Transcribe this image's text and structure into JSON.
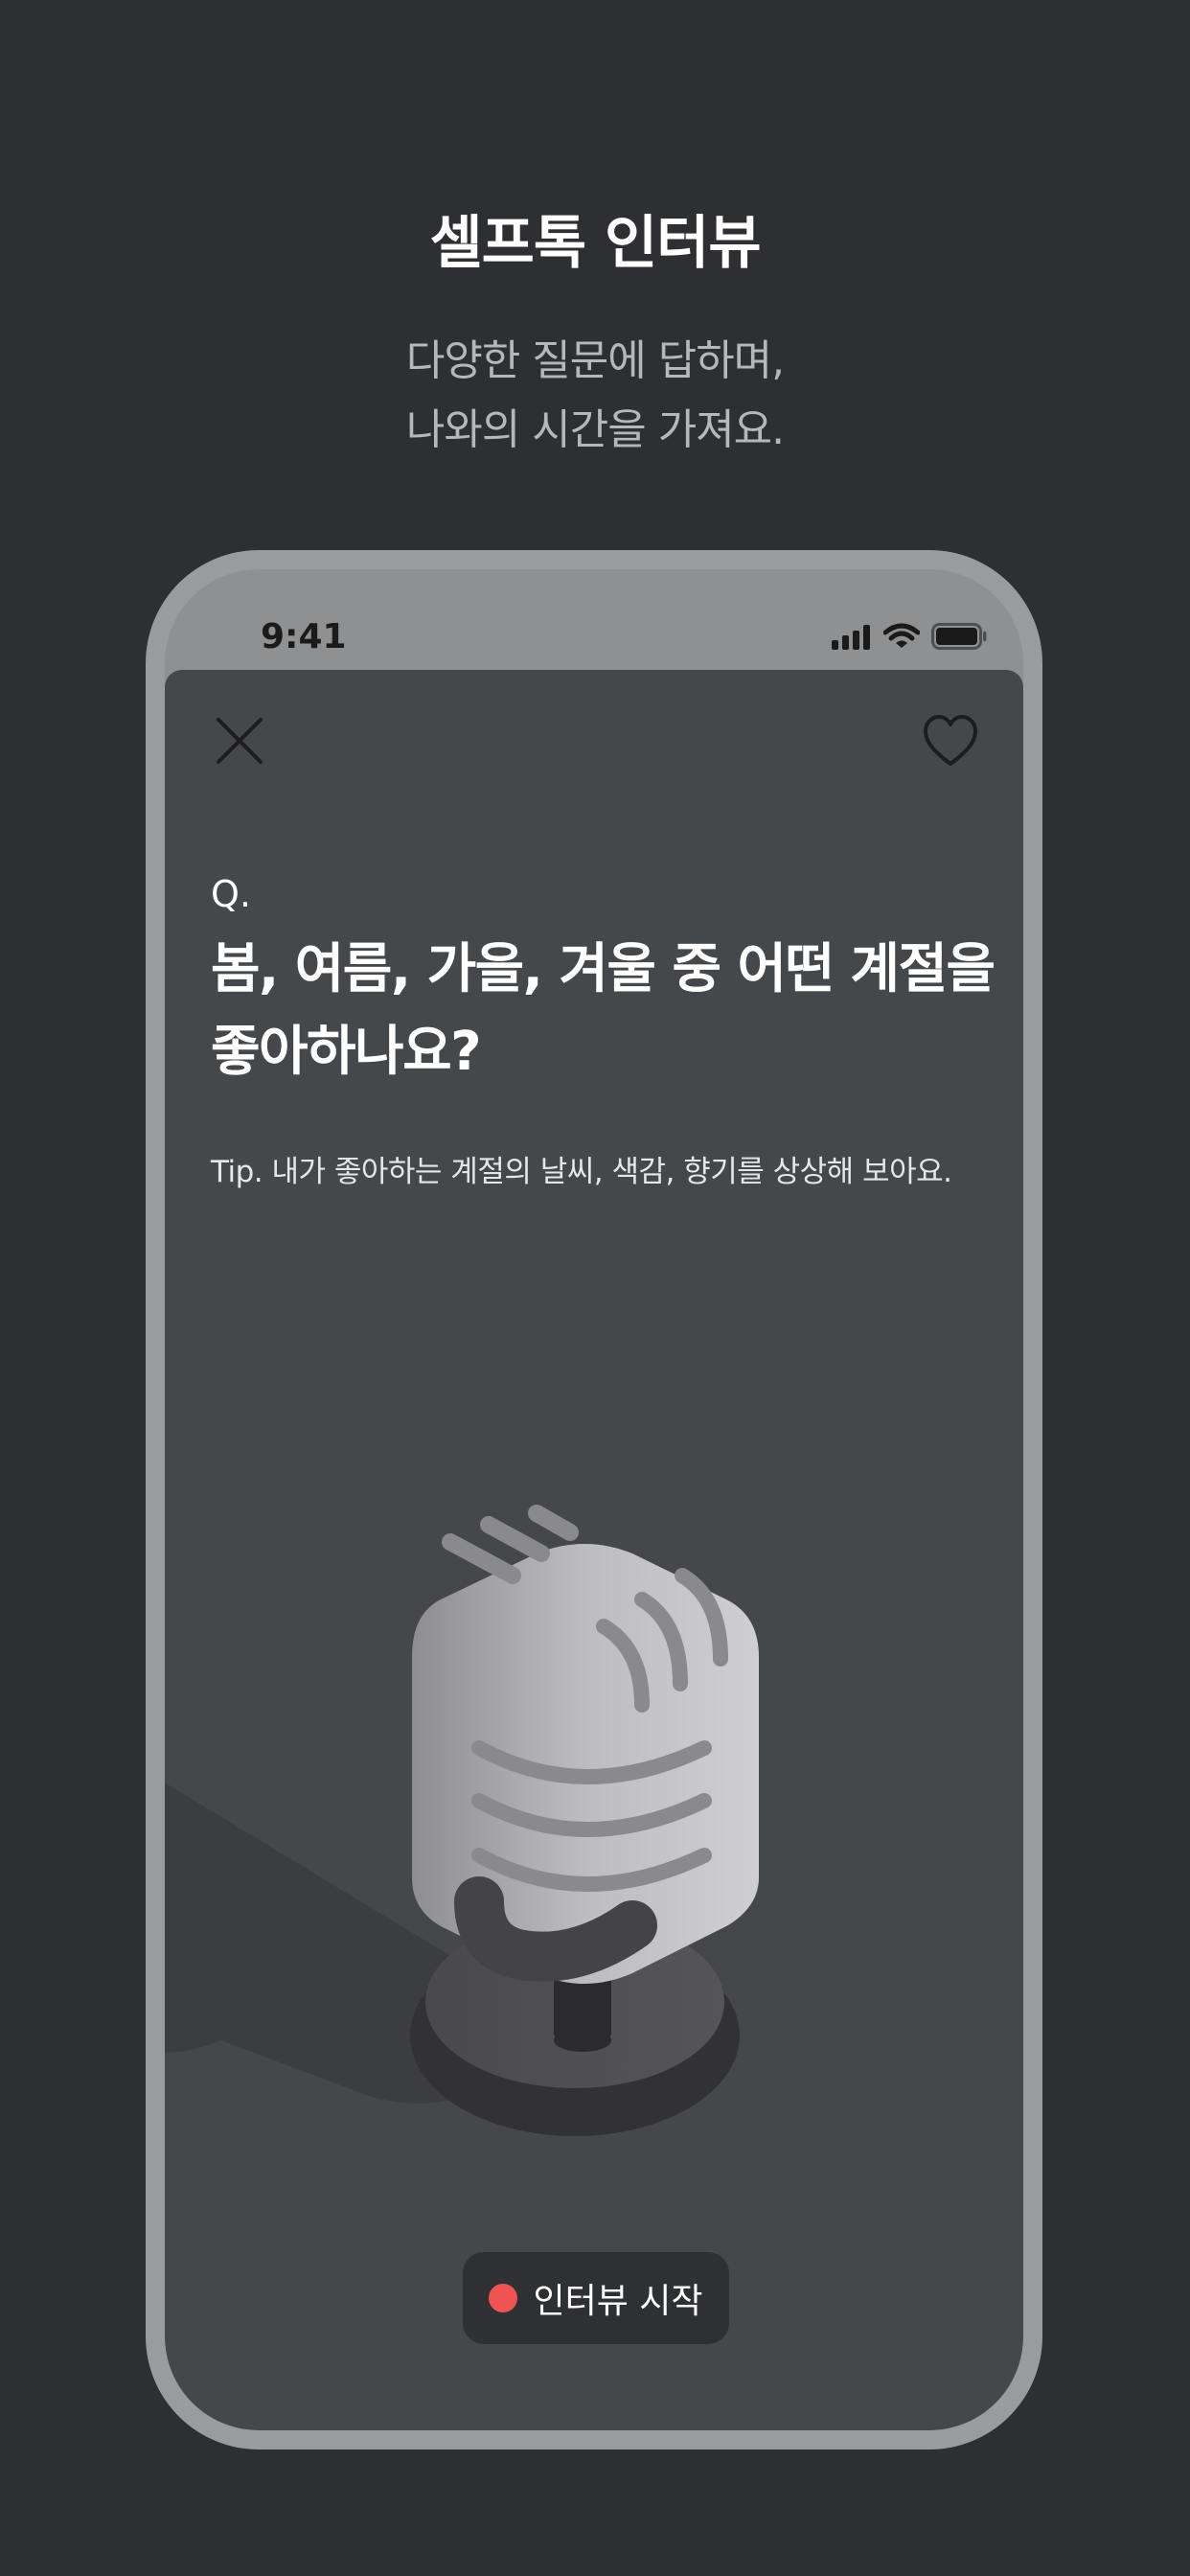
{
  "hero": {
    "title": "셀프톡 인터뷰",
    "subtitle_line1": "다양한 질문에 답하며,",
    "subtitle_line2": "나와의 시간을 가져요."
  },
  "status_bar": {
    "time": "9:41"
  },
  "toolbar": {
    "close_icon": "close-icon",
    "favorite_icon": "heart-icon"
  },
  "question": {
    "label": "Q.",
    "text": "봄, 여름, 가을, 겨울 중 어떤 계절을 좋아하나요?",
    "tip": "Tip. 내가 좋아하는 계절의 날씨, 색감, 향기를 상상해 보아요."
  },
  "start_button": {
    "label": "인터뷰 시작",
    "dot_color": "#f05452"
  },
  "colors": {
    "background": "#2e2f32",
    "screen": "#45484b",
    "phone_frame": "#9a9b9d"
  }
}
